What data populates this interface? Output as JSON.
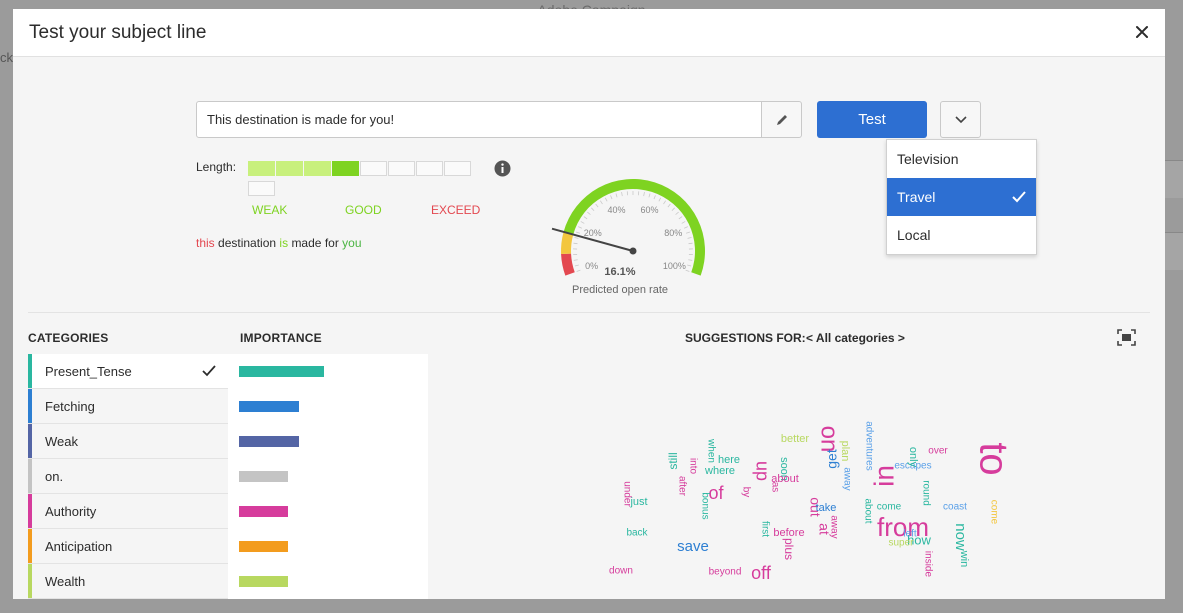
{
  "background": {
    "title": "Adobe Campaign",
    "side_text": "ck"
  },
  "modal": {
    "title": "Test your subject line"
  },
  "subject": {
    "value": "This destination is made for you!"
  },
  "test_button": {
    "label": "Test"
  },
  "dropdown": {
    "options": [
      {
        "label": "Television",
        "selected": false
      },
      {
        "label": "Travel",
        "selected": true
      },
      {
        "label": "Local",
        "selected": false
      }
    ]
  },
  "length": {
    "label": "Length:",
    "filled_segments": 4,
    "total_segments": 9,
    "colors": {
      "light": "#c8f07c",
      "active": "#7ed321",
      "empty": "#fafafa"
    },
    "scale": [
      {
        "label": "WEAK",
        "color": "#7ed321"
      },
      {
        "label": "GOOD",
        "color": "#7ed321"
      },
      {
        "label": "EXCEED",
        "color": "#e34850"
      }
    ]
  },
  "preview": {
    "words": [
      {
        "text": "this",
        "color": "#e34850"
      },
      {
        "text": "destination",
        "color": "#2c2c2c"
      },
      {
        "text": "is",
        "color": "#7ed321"
      },
      {
        "text": "made",
        "color": "#2c2c2c"
      },
      {
        "text": "for",
        "color": "#2c2c2c"
      },
      {
        "text": "you",
        "color": "#4bb543"
      }
    ]
  },
  "gauge": {
    "value_label": "16.1%",
    "value": 16.1,
    "caption": "Predicted open rate",
    "ticks": [
      "0%",
      "20%",
      "40%",
      "60%",
      "80%",
      "100%"
    ]
  },
  "categories": {
    "header": "CATEGORIES",
    "items": [
      {
        "label": "Present_Tense",
        "color": "#2ab7a0",
        "importance": 100,
        "selected": true
      },
      {
        "label": "Fetching",
        "color": "#2d7fd2",
        "importance": 71,
        "selected": false
      },
      {
        "label": "Weak",
        "color": "#5465a5",
        "importance": 71,
        "selected": false
      },
      {
        "label": "on.",
        "color": "#c4c4c4",
        "importance": 58,
        "selected": false
      },
      {
        "label": "Authority",
        "color": "#d63c9c",
        "importance": 58,
        "selected": false
      },
      {
        "label": "Anticipation",
        "color": "#f39c1e",
        "importance": 58,
        "selected": false
      },
      {
        "label": "Wealth",
        "color": "#b8d860",
        "importance": 58,
        "selected": false
      }
    ]
  },
  "importance": {
    "header": "IMPORTANCE"
  },
  "suggestions": {
    "label": "SUGGESTIONS FOR:",
    "filter": "< All categories >",
    "words": [
      {
        "text": "to",
        "color": "#d63c9c",
        "size": 40
      },
      {
        "text": "from",
        "color": "#d63c9c",
        "size": 26
      },
      {
        "text": "in",
        "color": "#d63c9c",
        "size": 28
      },
      {
        "text": "on",
        "color": "#d63c9c",
        "size": 24
      },
      {
        "text": "of",
        "color": "#d63c9c",
        "size": 18
      },
      {
        "text": "up",
        "color": "#d63c9c",
        "size": 18
      },
      {
        "text": "off",
        "color": "#d63c9c",
        "size": 18
      },
      {
        "text": "now",
        "color": "#2ab7a0",
        "size": 15
      },
      {
        "text": "save",
        "color": "#2d7fd2",
        "size": 15
      },
      {
        "text": "get",
        "color": "#2d7fd2",
        "size": 14
      },
      {
        "text": "out",
        "color": "#d63c9c",
        "size": 14
      },
      {
        "text": "at",
        "color": "#d63c9c",
        "size": 14
      },
      {
        "text": "how",
        "color": "#2ab7a0",
        "size": 13
      },
      {
        "text": "plus",
        "color": "#d63c9c",
        "size": 12
      },
      {
        "text": "still",
        "color": "#2ab7a0",
        "size": 12
      },
      {
        "text": "here",
        "color": "#2ab7a0",
        "size": 11
      },
      {
        "text": "where",
        "color": "#2ab7a0",
        "size": 11
      },
      {
        "text": "soon",
        "color": "#2ab7a0",
        "size": 11
      },
      {
        "text": "about",
        "color": "#d63c9c",
        "size": 11
      },
      {
        "text": "better",
        "color": "#b8d860",
        "size": 11
      },
      {
        "text": "over",
        "color": "#d63c9c",
        "size": 10
      },
      {
        "text": "escapes",
        "color": "#5aa0e8",
        "size": 10
      },
      {
        "text": "only",
        "color": "#2ab7a0",
        "size": 11
      },
      {
        "text": "adventures",
        "color": "#5aa0e8",
        "size": 10
      },
      {
        "text": "plan",
        "color": "#b8d860",
        "size": 11
      },
      {
        "text": "away",
        "color": "#5aa0e8",
        "size": 10
      },
      {
        "text": "take",
        "color": "#2d7fd2",
        "size": 11
      },
      {
        "text": "come",
        "color": "#2ab7a0",
        "size": 10
      },
      {
        "text": "round",
        "color": "#2ab7a0",
        "size": 10
      },
      {
        "text": "coast",
        "color": "#5aa0e8",
        "size": 10
      },
      {
        "text": "come",
        "color": "#f3c63e",
        "size": 10
      },
      {
        "text": "just",
        "color": "#2ab7a0",
        "size": 11
      },
      {
        "text": "into",
        "color": "#d63c9c",
        "size": 10
      },
      {
        "text": "after",
        "color": "#d63c9c",
        "size": 10
      },
      {
        "text": "when",
        "color": "#2ab7a0",
        "size": 10
      },
      {
        "text": "as",
        "color": "#d63c9c",
        "size": 10
      },
      {
        "text": "by",
        "color": "#d63c9c",
        "size": 10
      },
      {
        "text": "under",
        "color": "#d63c9c",
        "size": 10
      },
      {
        "text": "back",
        "color": "#2ab7a0",
        "size": 10
      },
      {
        "text": "bonus",
        "color": "#2ab7a0",
        "size": 10
      },
      {
        "text": "first",
        "color": "#2ab7a0",
        "size": 10
      },
      {
        "text": "before",
        "color": "#d63c9c",
        "size": 11
      },
      {
        "text": "away",
        "color": "#d63c9c",
        "size": 10
      },
      {
        "text": "about",
        "color": "#2ab7a0",
        "size": 10
      },
      {
        "text": "left",
        "color": "#5aa0e8",
        "size": 10
      },
      {
        "text": "super",
        "color": "#b8d860",
        "size": 10
      },
      {
        "text": "win",
        "color": "#2ab7a0",
        "size": 11
      },
      {
        "text": "down",
        "color": "#d63c9c",
        "size": 10
      },
      {
        "text": "beyond",
        "color": "#d63c9c",
        "size": 10
      },
      {
        "text": "inside",
        "color": "#d63c9c",
        "size": 10
      }
    ]
  }
}
